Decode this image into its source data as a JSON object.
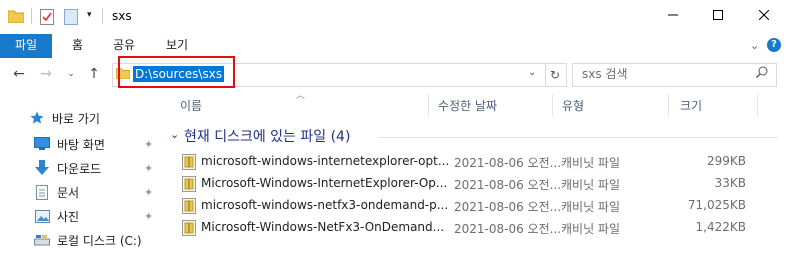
{
  "window": {
    "title": "sxs"
  },
  "ribbon": {
    "tabs": [
      "파일",
      "홈",
      "공유",
      "보기"
    ]
  },
  "address": {
    "path": "D:\\sources\\sxs"
  },
  "search": {
    "placeholder": "sxs 검색"
  },
  "columns": {
    "name": "이름",
    "date": "수정한 날짜",
    "type": "유형",
    "size": "크기"
  },
  "nav": {
    "quick_access": "바로 가기",
    "items": [
      "바탕 화면",
      "다운로드",
      "문서",
      "사진",
      "로컬 디스크 (C:)"
    ]
  },
  "group": {
    "label": "현재 디스크에 있는 파일 (4)"
  },
  "files": [
    {
      "name": "microsoft-windows-internetexplorer-opt...",
      "date": "2021-08-06 오전...",
      "type": "캐비닛 파일",
      "size": "299KB"
    },
    {
      "name": "Microsoft-Windows-InternetExplorer-Op...",
      "date": "2021-08-06 오전...",
      "type": "캐비닛 파일",
      "size": "33KB"
    },
    {
      "name": "microsoft-windows-netfx3-ondemand-p...",
      "date": "2021-08-06 오전...",
      "type": "캐비닛 파일",
      "size": "71,025KB"
    },
    {
      "name": "Microsoft-Windows-NetFx3-OnDemand...",
      "date": "2021-08-06 오전...",
      "type": "캐비닛 파일",
      "size": "1,422KB"
    }
  ],
  "colors": {
    "accent": "#1979ca",
    "selection": "#0078d7",
    "highlight_border": "#e01010"
  }
}
